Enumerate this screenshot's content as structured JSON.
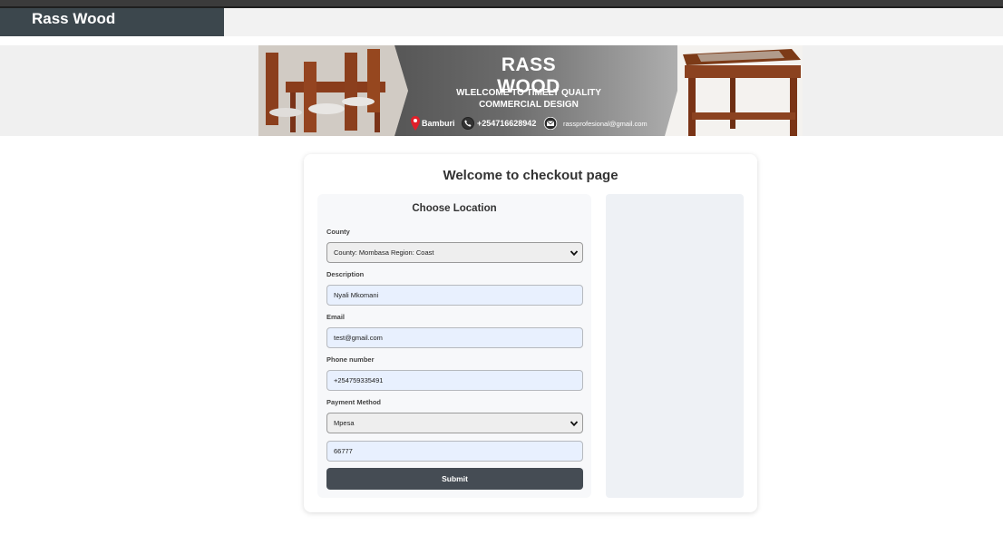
{
  "navbar": {
    "brand": "Rass Wood"
  },
  "banner": {
    "title": "RASS WOOD",
    "subtitle_line1": "WLELCOME TO TIMELY QUALITY",
    "subtitle_line2": "COMMERCIAL DESIGN",
    "location": "Bamburi",
    "phone": "+254716628942",
    "email": "rassprofesional@gmail.com"
  },
  "checkout": {
    "title": "Welcome to checkout page",
    "form": {
      "heading": "Choose Location",
      "county_label": "County",
      "county_value": "County: Mombasa Region: Coast",
      "description_label": "Description",
      "description_value": "Nyali Mkomani",
      "email_label": "Email",
      "email_value": "test@gmail.com",
      "phone_label": "Phone number",
      "phone_value": "+254759335491",
      "payment_label": "Payment Method",
      "payment_value": "Mpesa",
      "code_value": "66777",
      "submit_label": "Submit"
    }
  },
  "icons": [
    "location-pin-icon",
    "phone-icon",
    "email-icon",
    "chevron-down-icon"
  ],
  "colors": {
    "brand_bg": "#3c474d",
    "submit_bg": "#454c54",
    "input_bg": "#e8f0fe",
    "pin": "#e0202a"
  }
}
